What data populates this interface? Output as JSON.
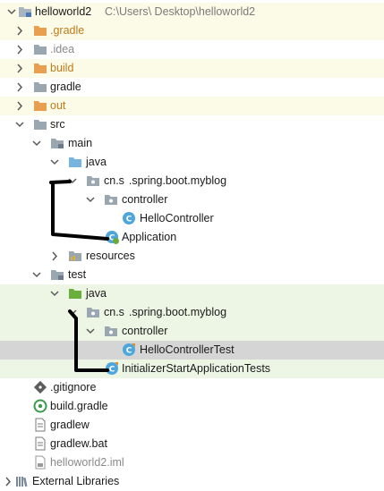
{
  "project": {
    "name": "helloworld2",
    "path": "C:\\Users\\        Desktop\\helloworld2"
  },
  "tree": {
    "gradle_hidden": ".gradle",
    "idea": ".idea",
    "build": "build",
    "gradle": "gradle",
    "out": "out",
    "src": "src",
    "main": "main",
    "main_java": "java",
    "main_package": "cn.s  .spring.boot.myblog",
    "main_controller": "controller",
    "hello_controller": "HelloController",
    "application": "Application",
    "resources": "resources",
    "test": "test",
    "test_java": "java",
    "test_package": "cn.s  .spring.boot.myblog",
    "test_controller": "controller",
    "hello_controller_test": "HelloControllerTest",
    "initializer_test": "InitializerStartApplicationTests",
    "gitignore": ".gitignore",
    "build_gradle": "build.gradle",
    "gradlew": "gradlew",
    "gradlew_bat": "gradlew.bat",
    "iml": "helloworld2.iml",
    "external_libraries": "External Libraries"
  },
  "icons": {
    "folder": "folder-icon",
    "excluded_folder": "excluded-folder-icon",
    "source_folder": "source-folder-icon",
    "test_folder": "test-source-folder-icon",
    "package": "package-icon",
    "class": "class-icon",
    "spring_boot_class": "spring-boot-class-icon",
    "test_class": "test-class-icon",
    "git_file": "git-file-icon",
    "gradle_file": "gradle-file-icon",
    "text_file": "text-file-icon",
    "module_file": "module-file-icon",
    "libraries": "libraries-icon"
  },
  "colors": {
    "module_highlight": "#fbfbe7",
    "test_highlight": "#edf6e4",
    "selection": "#d5d5d5",
    "excluded_text": "#c07a1a",
    "annotation_stroke": "#000000"
  }
}
